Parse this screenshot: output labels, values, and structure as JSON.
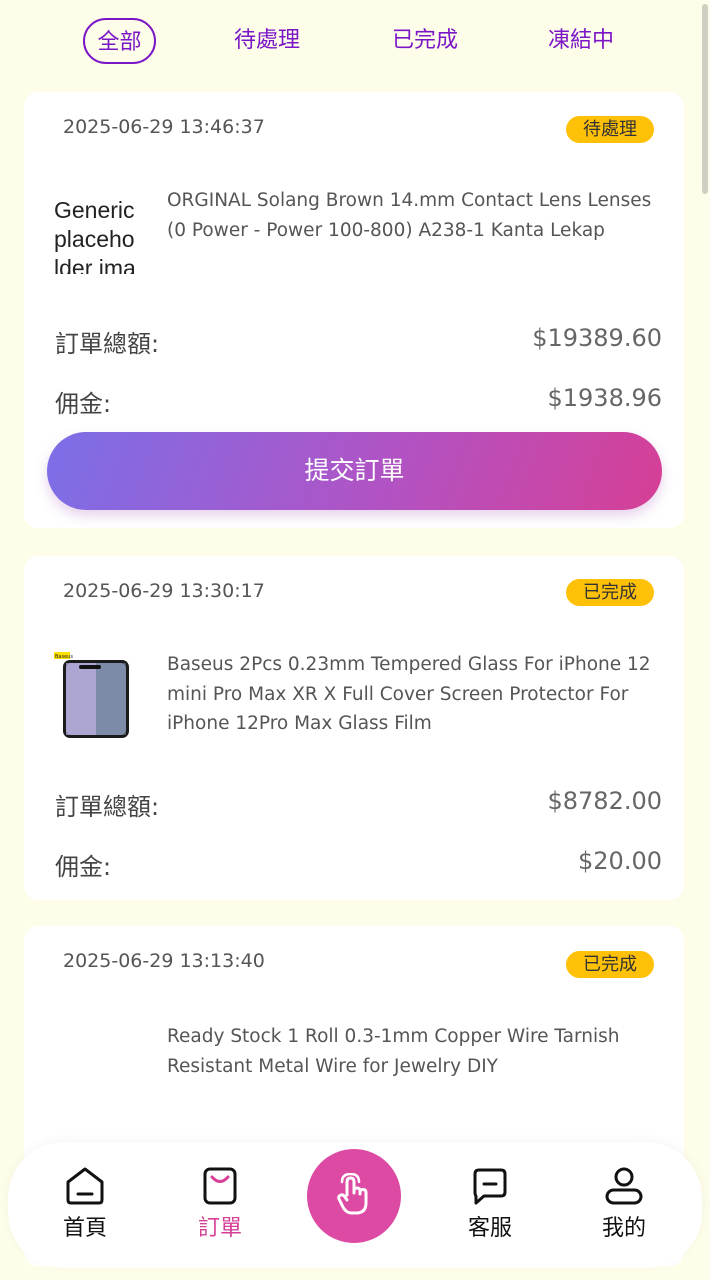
{
  "tabs": [
    {
      "label": "全部",
      "active": true
    },
    {
      "label": "待處理",
      "active": false
    },
    {
      "label": "已完成",
      "active": false
    },
    {
      "label": "凍結中",
      "active": false
    }
  ],
  "orders": [
    {
      "time": "2025-06-29 13:46:37",
      "status": "待處理",
      "image_alt": "Generic placeholder image",
      "product": "ORGINAL Solang Brown 14.mm Contact Lens Lenses (0 Power - Power 100-800) A238-1 Kanta Lekap",
      "total_label": "訂單總額:",
      "total": "$19389.60",
      "commission_label": "佣金:",
      "commission": "$1938.96",
      "submit_label": "提交訂單"
    },
    {
      "time": "2025-06-29 13:30:17",
      "status": "已完成",
      "image_text": "Baseus",
      "product": "Baseus 2Pcs 0.23mm Tempered Glass For iPhone 12 mini Pro Max XR X Full Cover Screen Protector For iPhone 12Pro Max Glass Film",
      "total_label": "訂單總額:",
      "total": "$8782.00",
      "commission_label": "佣金:",
      "commission": "$20.00"
    },
    {
      "time": "2025-06-29 13:13:40",
      "status": "已完成",
      "product": "Ready Stock 1 Roll 0.3-1mm Copper Wire Tarnish Resistant Metal Wire for Jewelry DIY"
    }
  ],
  "nav": {
    "home": "首頁",
    "orders": "訂單",
    "service": "客服",
    "mine": "我的"
  },
  "colors": {
    "accent": "#7b16c6",
    "badge": "#ffc107",
    "nav_active": "#d63f95",
    "center_button": "#dd4aa3"
  }
}
